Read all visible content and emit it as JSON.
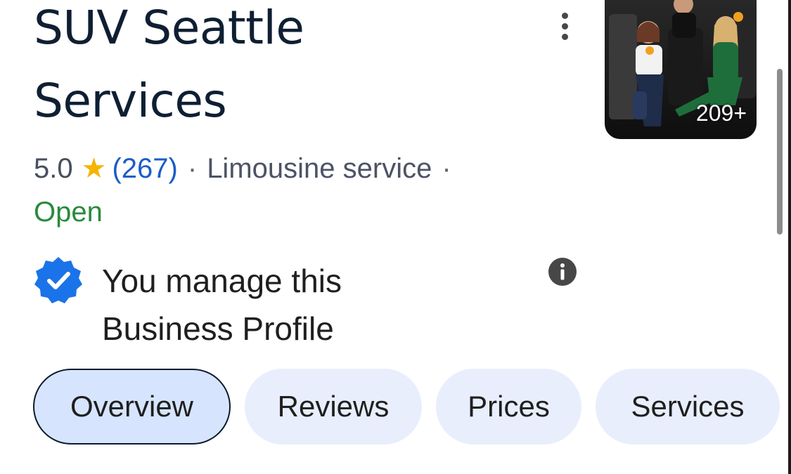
{
  "business": {
    "name_line1": "SUV Seattle",
    "name_line2": "Services",
    "rating": "5.0",
    "review_count": "(267)",
    "separator": "·",
    "category": "Limousine service",
    "status": "Open",
    "photo_count": "209+"
  },
  "profile": {
    "manage_line1": "You manage this",
    "manage_line2": "Business Profile"
  },
  "tabs": [
    {
      "label": "Overview",
      "active": true
    },
    {
      "label": "Reviews",
      "active": false
    },
    {
      "label": "Prices",
      "active": false
    },
    {
      "label": "Services",
      "active": false
    }
  ],
  "icons": {
    "star": "★",
    "more": "more-vert-icon",
    "verified": "verified-badge-icon",
    "info": "info-icon"
  },
  "colors": {
    "review_link": "#1a5dc8",
    "star": "#f5b400",
    "open_status": "#2a8a3e",
    "verified_badge": "#1a73e8",
    "tab_bg": "#e8eefc",
    "tab_active_bg": "#d6e5fd"
  }
}
